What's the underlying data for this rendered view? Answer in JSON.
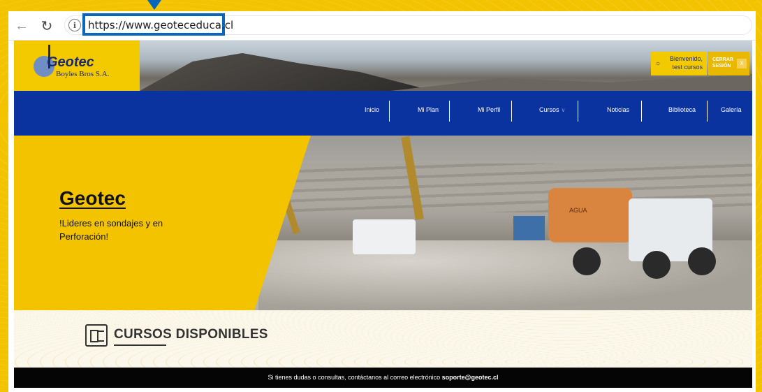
{
  "browser": {
    "url": "https://www.geoteceduca.cl"
  },
  "header": {
    "logo_name": "Geotec",
    "logo_sub": "Boyles Bros S.A.",
    "welcome": "Bienvenido,",
    "username": "test cursos",
    "logout": "CERRAR SESIÓN",
    "close": "x"
  },
  "nav": {
    "items": [
      "Inicio",
      "Mi Plan",
      "Mi Perfil",
      "Cursos",
      "Noticias",
      "Biblioteca",
      "Galería"
    ]
  },
  "hero": {
    "title": "Geotec",
    "subtitle": "!Lideres en sondajes y en Perforación!",
    "tank_label": "AGUA"
  },
  "courses": {
    "title": "CURSOS DISPONIBLES"
  },
  "footer": {
    "text": "Si tienes dudas o consultas, contáctanos al correo electrónico ",
    "email": "soporte@geotec.cl"
  },
  "colors": {
    "brand_yellow": "#f3c300",
    "nav_blue": "#0b33a0",
    "highlight_blue": "#0a66b8"
  },
  "icons": [
    "back-arrow-icon",
    "reload-icon",
    "info-icon",
    "user-icon",
    "close-icon",
    "courses-list-icon",
    "chevron-down-icon"
  ]
}
